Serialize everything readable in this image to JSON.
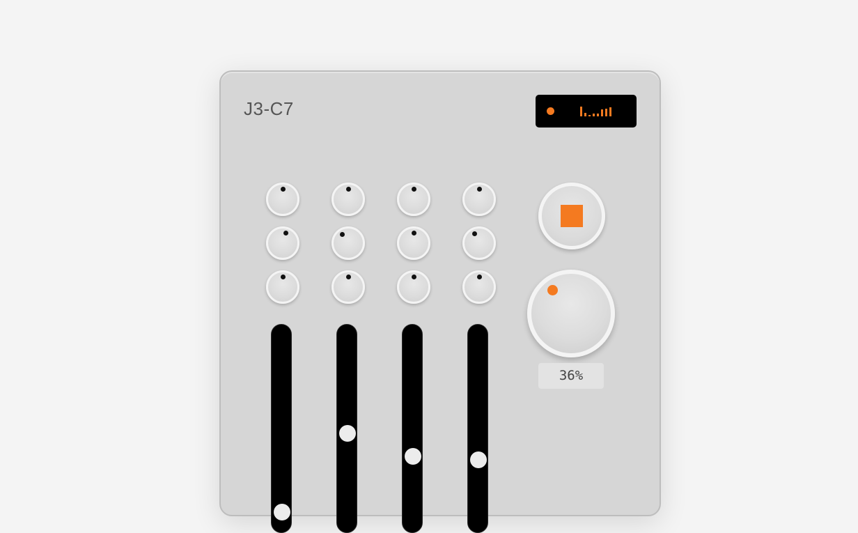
{
  "device": {
    "model": "J3-C7"
  },
  "display": {
    "led_color": "#f47a20",
    "bar_color": "#f47a20",
    "meter_levels": [
      0.9,
      0.3,
      0.15,
      0.25,
      0.25,
      0.6,
      0.7,
      0.8
    ]
  },
  "knob_grid": [
    [
      0.0,
      0.0,
      0.0,
      0.0
    ],
    [
      0.1,
      -0.18,
      0.0,
      -0.15
    ],
    [
      0.0,
      0.0,
      0.0,
      0.0
    ]
  ],
  "faders": [
    {
      "level": 0.07
    },
    {
      "level": 0.48
    },
    {
      "level": 0.36
    },
    {
      "level": 0.34
    }
  ],
  "transport": {
    "stop_color": "#f47a20"
  },
  "master": {
    "indicator_color": "#f47a20",
    "percent": 0.36,
    "readout": "36%"
  }
}
